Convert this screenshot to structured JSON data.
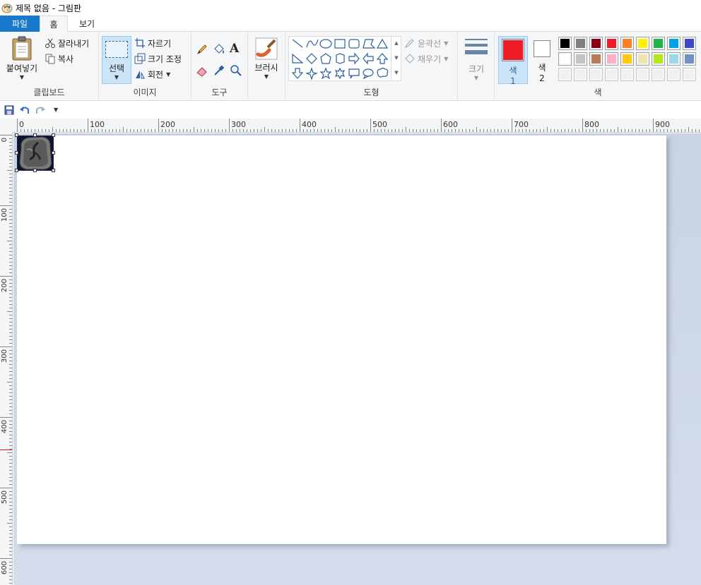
{
  "window": {
    "title": "제목 없음 - 그림판"
  },
  "tabs": {
    "file": "파일",
    "home": "홈",
    "view": "보기"
  },
  "clipboard": {
    "paste": "붙여넣기",
    "cut": "잘라내기",
    "copy": "복사",
    "label": "클립보드"
  },
  "image": {
    "select": "선택",
    "crop": "자르기",
    "resize": "크기 조정",
    "rotate": "회전",
    "label": "이미지"
  },
  "tools": {
    "label": "도구"
  },
  "brushes": {
    "label": "브러시"
  },
  "shapes": {
    "outline": "윤곽선",
    "fill": "채우기",
    "label": "도형"
  },
  "size": {
    "label": "크기"
  },
  "colors": {
    "color1_label": "색",
    "color1_num": "1",
    "color2_label": "색",
    "color2_num": "2",
    "label": "색",
    "color1": "#ed1c24",
    "color2": "#ffffff",
    "palette_row1": [
      "#000000",
      "#7f7f7f",
      "#880015",
      "#ed1c24",
      "#ff7f27",
      "#fff200",
      "#22b14c",
      "#00a2e8",
      "#3f48cc",
      "#a349a4"
    ],
    "palette_row2": [
      "#ffffff",
      "#c3c3c3",
      "#b97a57",
      "#ffaec9",
      "#ffc90e",
      "#efe4b0",
      "#b5e61d",
      "#99d9ea",
      "#7092be",
      "#c8bfe7"
    ],
    "palette_row3": [
      "#f0f0f0",
      "#f0f0f0",
      "#f0f0f0",
      "#f0f0f0",
      "#f0f0f0",
      "#f0f0f0",
      "#f0f0f0",
      "#f0f0f0",
      "#f0f0f0",
      "#f0f0f0"
    ]
  },
  "rulers": {
    "horizontal": [
      "0",
      "100",
      "200",
      "300",
      "400",
      "500",
      "600",
      "700",
      "800",
      "900"
    ],
    "vertical": [
      "0",
      "100",
      "200",
      "300",
      "400",
      "500",
      "600"
    ]
  }
}
